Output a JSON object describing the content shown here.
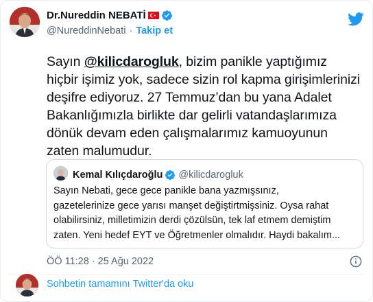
{
  "tweet": {
    "author": {
      "display_name": "Dr.Nureddin NEBATİ",
      "handle": "@NureddinNebati",
      "follow_label": "Takip et",
      "flag_icon": "turkey-flag-icon",
      "verified_icon": "verified-badge-icon"
    },
    "text": {
      "prefix": "Sayın ",
      "mention": "@kilicdarogluk",
      "body": ", bizim panikle yaptığımız hiçbir işimiz yok, sadece sizin rol kapma girişimlerinizi deşifre ediyoruz. 27 Temmuz’dan bu yana Adalet Bakanlığımızla birlikte dar gelirli vatandaşlarımıza dönük devam eden çalışmalarımız kamuoyunun zaten malumudur."
    },
    "quoted": {
      "display_name": "Kemal Kılıçdaroğlu",
      "handle": "@kilicdarogluk",
      "text": "Sayın Nebati, gece gece panikle bana yazmışsınız,\ngazetelerinize gece yarısı manşet değiştirtmişsiniz. Oysa rahat\nolabilirsiniz, milletimizin derdi çözülsün, tek laf etmem demiştim\nzaten. Yeni hedef EYT ve Öğretmenler olmalıdır. Haydi bakalım..."
    },
    "timestamp": "ÖÖ 11:28 · 25 Ağu 2022",
    "read_more": "Sohbetin tamamını Twitter'da oku"
  },
  "colors": {
    "accent": "#1d9bf0",
    "text": "#0f1419",
    "secondary": "#536471",
    "flag_red": "#e30a17"
  }
}
